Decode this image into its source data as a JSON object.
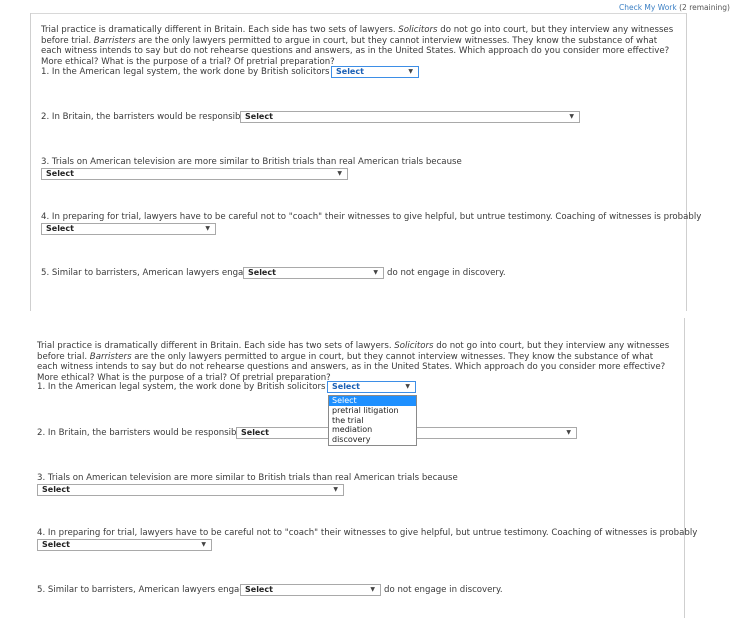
{
  "header": {
    "check_link": "Check My Work",
    "remaining": "(2 remaining)"
  },
  "passage": {
    "p1": "Trial practice is dramatically different in Britain. Each side has two sets of lawyers. ",
    "solicitors": "Solicitors",
    "p2": " do not go into court, but they interview any witnesses before trial. ",
    "barristers": "Barristers",
    "p3": " are the only lawyers permitted to argue in court, but they cannot interview witnesses. They know the substance of what each witness intends to say but do not rehearse questions and answers, as in the United States. Which approach do you consider more effective? More ethical? What is the purpose of a trial? Of pretrial preparation?"
  },
  "questions": {
    "q1": "1. In the American legal system, the work done by British solicitors is called",
    "q2": "2. In Britain, the barristers would be responsible for",
    "q3": "3. Trials on American television are more similar to British trials than real American trials because",
    "q4": "4. In preparing for trial, lawyers have to be careful not to \"coach\" their witnesses to give helpful, but untrue testimony. Coaching of witnesses is probably",
    "q5_before": "5. Similar to barristers, American lawyers engaged in",
    "q5_after": "do not engage in discovery."
  },
  "select_label": "Select",
  "dropdown": {
    "options": [
      "Select",
      "pretrial litigation",
      "the trial",
      "mediation",
      "discovery"
    ],
    "highlighted": "Select"
  },
  "colors": {
    "link": "#3b7fc4",
    "focus": "#3d8ee6",
    "highlight": "#1e90ff"
  }
}
